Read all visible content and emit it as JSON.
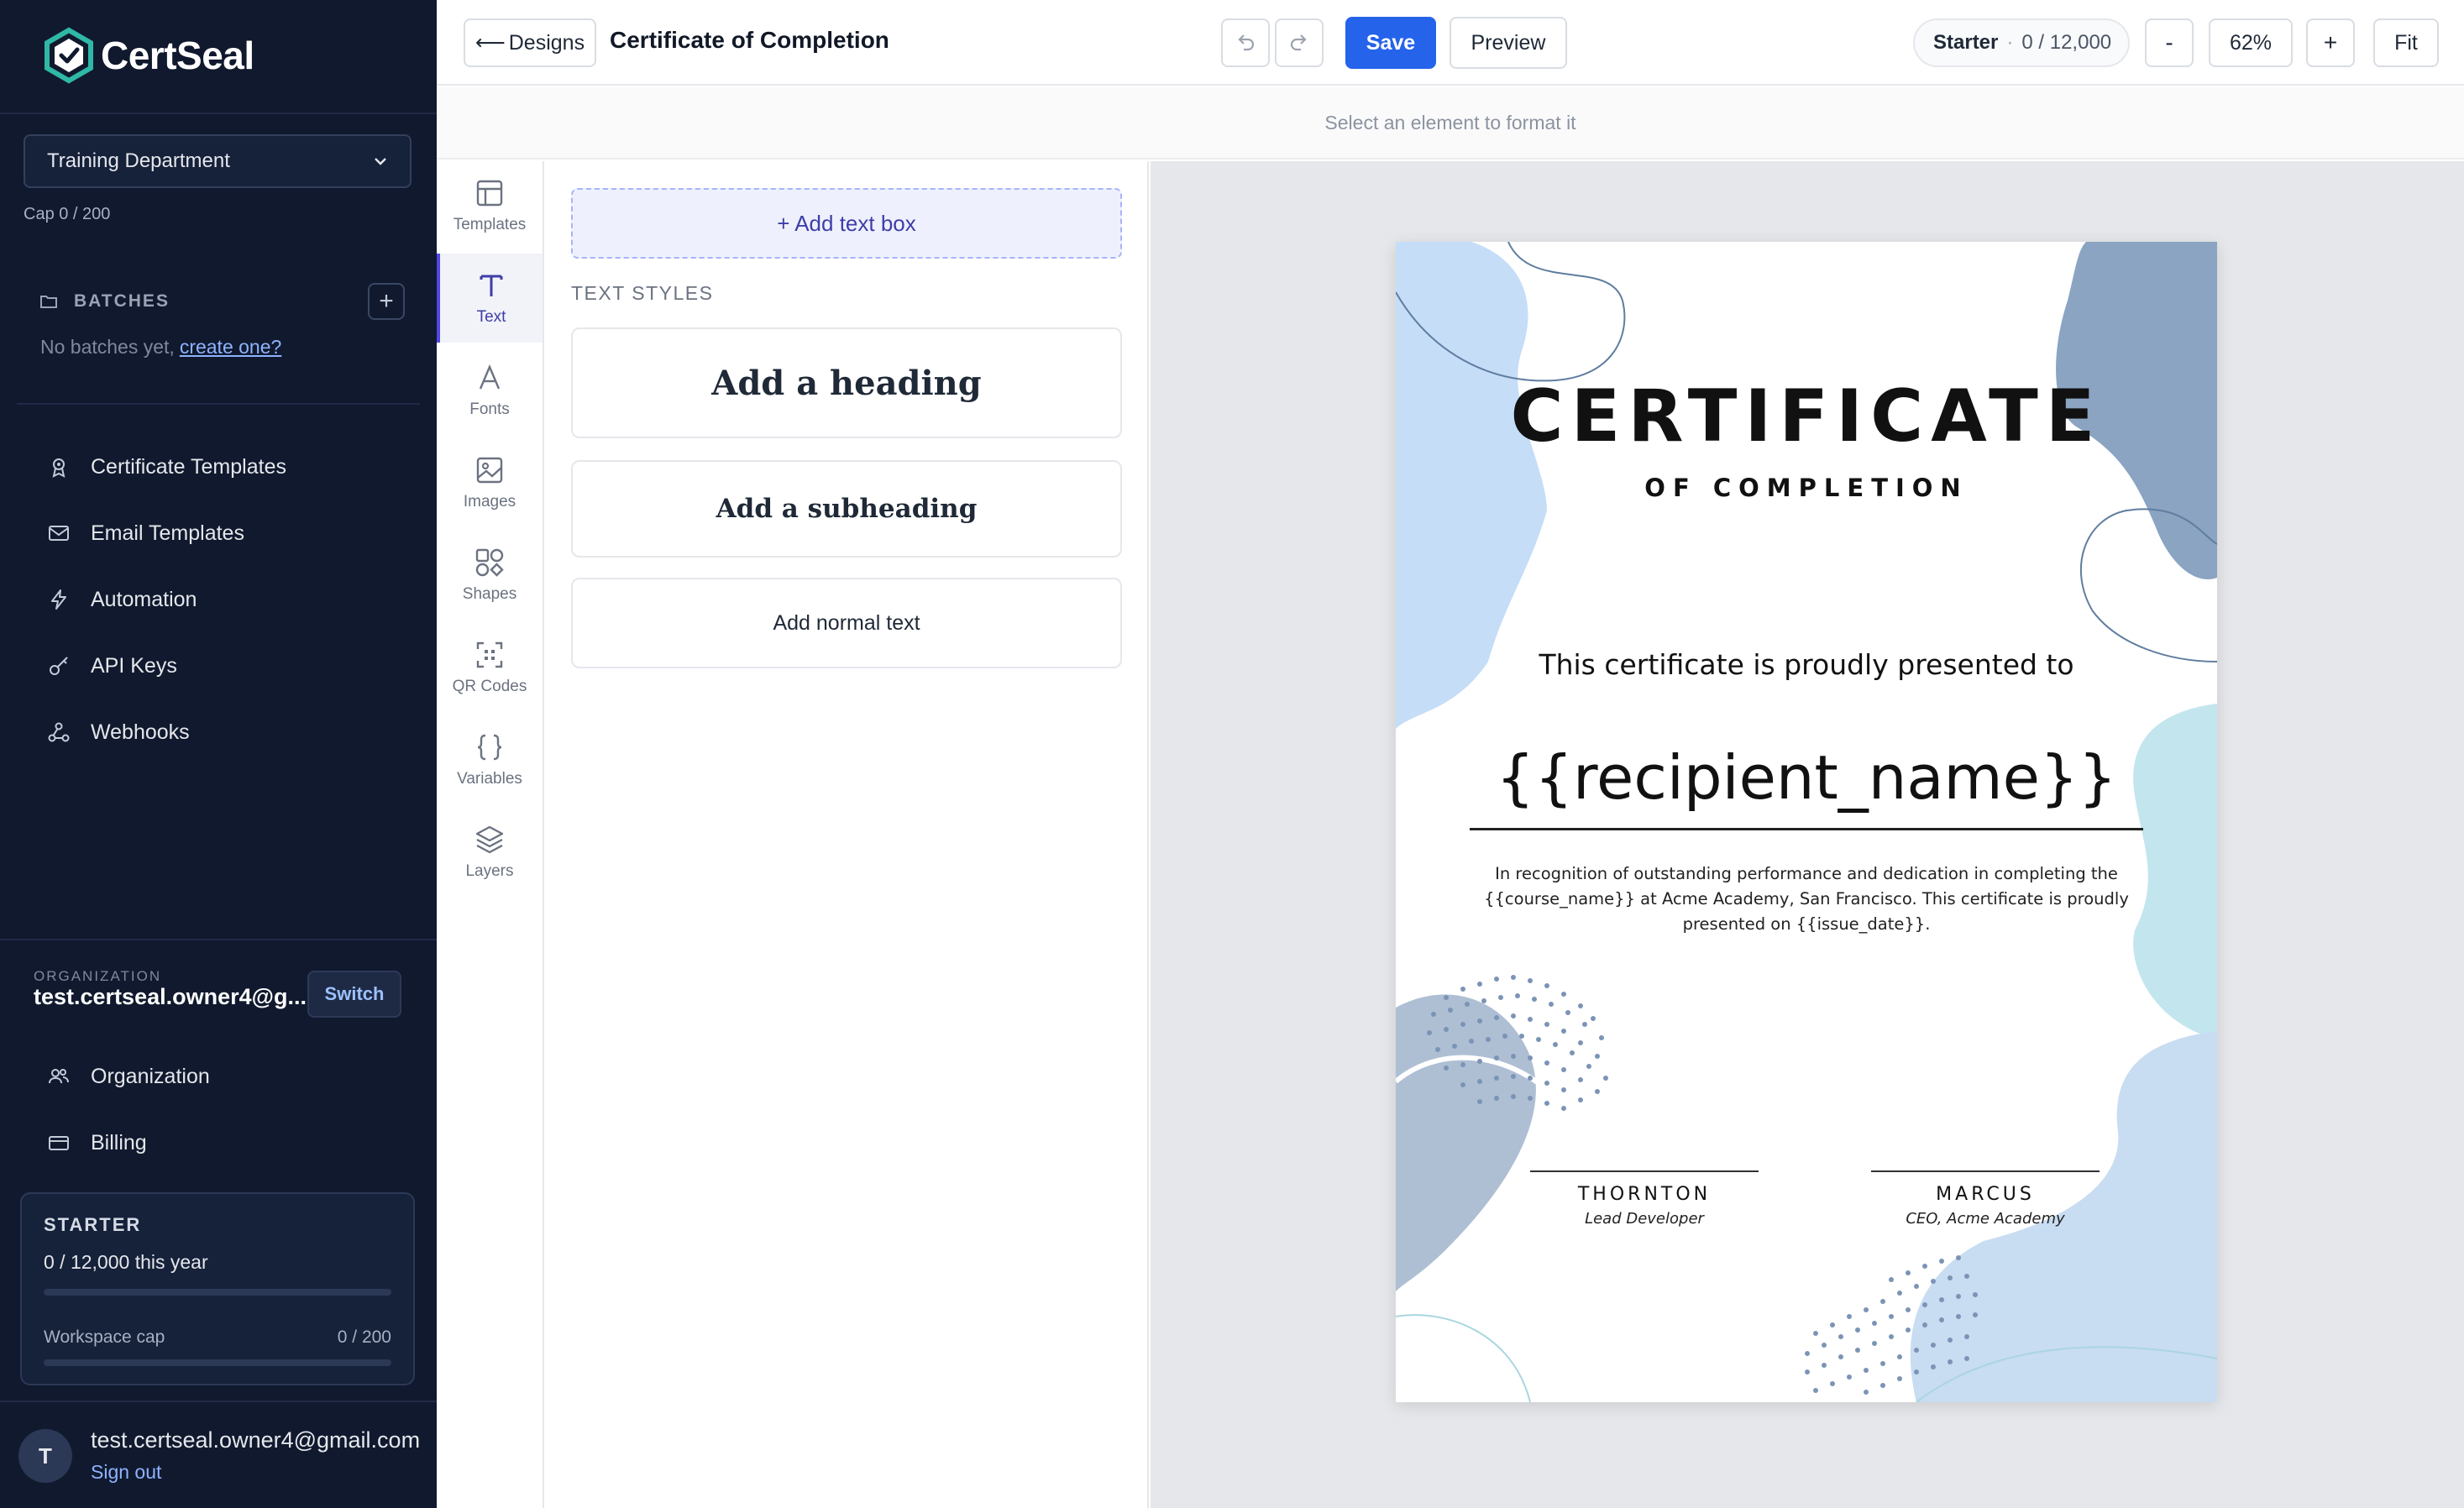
{
  "app": {
    "name": "CertSeal"
  },
  "sidebar": {
    "workspace": "Training Department",
    "cap": "Cap 0 / 200",
    "batches": {
      "title": "BATCHES",
      "empty_text": "No batches yet,",
      "create_link": "create one?"
    },
    "nav": [
      {
        "label": "Certificate Templates",
        "icon": "certificate-icon"
      },
      {
        "label": "Email Templates",
        "icon": "mail-icon"
      },
      {
        "label": "Automation",
        "icon": "bolt-icon"
      },
      {
        "label": "API Keys",
        "icon": "key-icon"
      },
      {
        "label": "Webhooks",
        "icon": "webhook-icon"
      }
    ],
    "organization": {
      "label": "ORGANIZATION",
      "name": "test.certseal.owner4@g...",
      "switch_label": "Switch"
    },
    "org_nav": [
      {
        "label": "Organization",
        "icon": "users-icon"
      },
      {
        "label": "Billing",
        "icon": "card-icon"
      }
    ],
    "plan": {
      "name": "STARTER",
      "usage": "0 / 12,000 this year",
      "usage_fraction": 0,
      "cap_label": "Workspace cap",
      "cap_value": "0 / 200",
      "cap_fraction": 0
    },
    "user": {
      "initial": "T",
      "email": "test.certseal.owner4@gmail.com",
      "sign_out": "Sign out"
    }
  },
  "topbar": {
    "back_label": "Designs",
    "title": "Certificate of Completion",
    "save_label": "Save",
    "preview_label": "Preview",
    "plan_name": "Starter",
    "plan_usage": "0 / 12,000",
    "zoom_out_label": "-",
    "zoom": "62%",
    "zoom_in_label": "+",
    "fit_label": "Fit"
  },
  "hint": "Select an element to format it",
  "tool_rail": [
    {
      "label": "Templates",
      "icon": "templates-icon",
      "active": false
    },
    {
      "label": "Text",
      "icon": "text-icon",
      "active": true
    },
    {
      "label": "Fonts",
      "icon": "fonts-icon",
      "active": false
    },
    {
      "label": "Images",
      "icon": "image-icon",
      "active": false
    },
    {
      "label": "Shapes",
      "icon": "shapes-icon",
      "active": false
    },
    {
      "label": "QR Codes",
      "icon": "qr-icon",
      "active": false
    },
    {
      "label": "Variables",
      "icon": "braces-icon",
      "active": false
    },
    {
      "label": "Layers",
      "icon": "layers-icon",
      "active": false
    }
  ],
  "panel": {
    "add_text_box": "+ Add text box",
    "section_title": "TEXT STYLES",
    "heading": "Add a heading",
    "subheading": "Add a subheading",
    "normal": "Add normal text"
  },
  "certificate": {
    "title": "CERTIFICATE",
    "subtitle": "OF COMPLETION",
    "presented": "This certificate is proudly presented to",
    "recipient": "{{recipient_name}}",
    "body": "In recognition of outstanding performance and dedication in completing the {{course_name}} at Acme Academy, San Francisco. This certificate is proudly presented on {{issue_date}}.",
    "signatures": [
      {
        "name": "THORNTON",
        "title": "Lead Developer"
      },
      {
        "name": "MARCUS",
        "title": "CEO, Acme Academy"
      }
    ]
  },
  "colors": {
    "sidebar_bg": "#10192e",
    "accent": "#2563eb",
    "active_tool": "#4f46e5",
    "link": "#8fb3ff"
  }
}
